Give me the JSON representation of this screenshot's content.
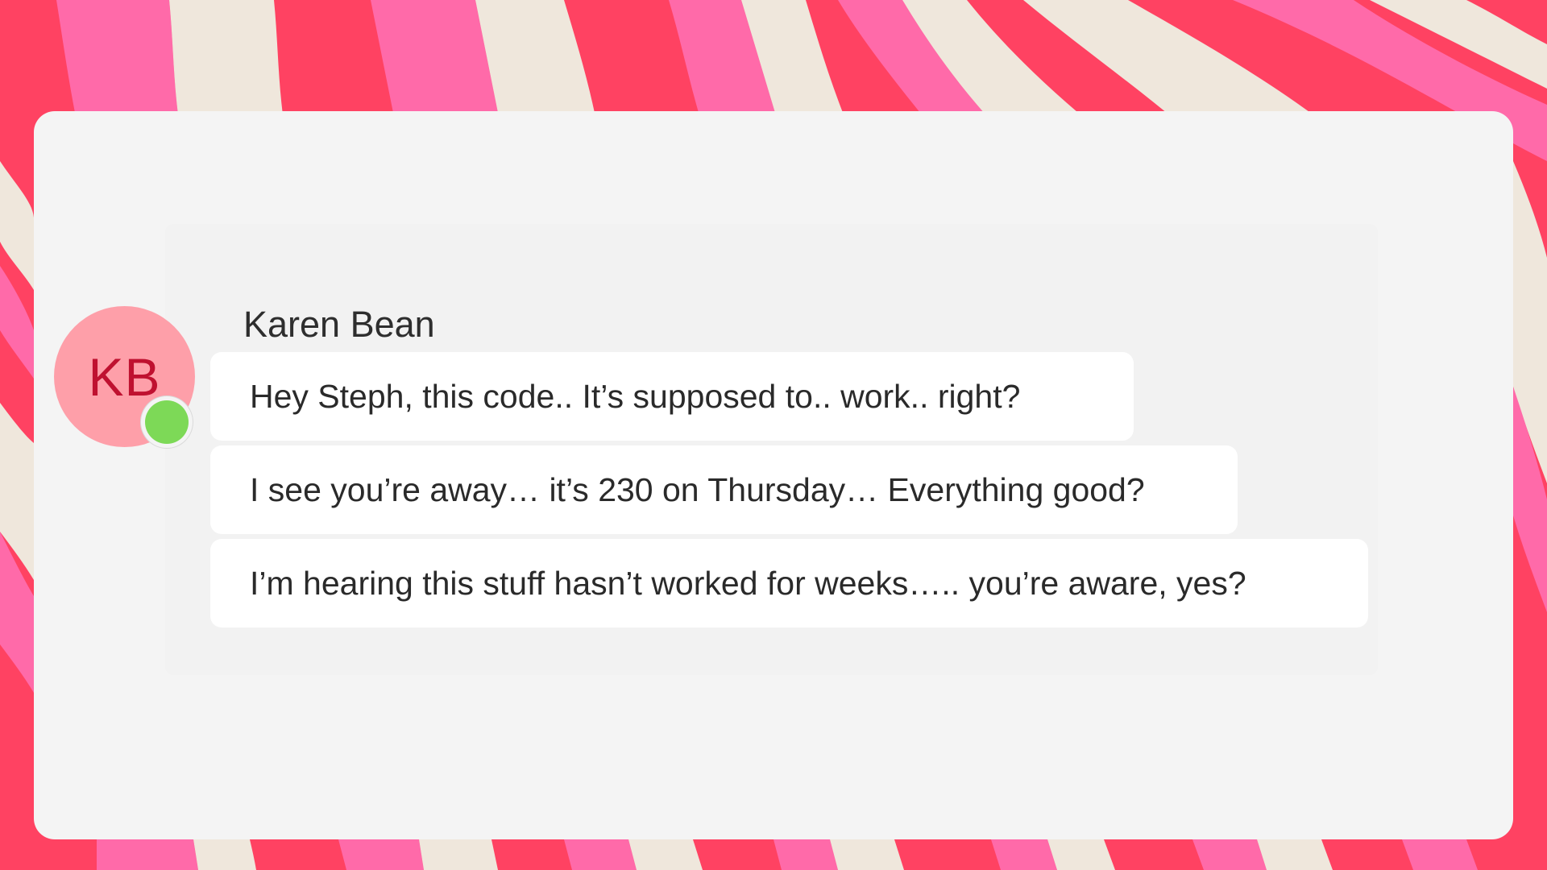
{
  "colors": {
    "stripe_red": "#ff4262",
    "stripe_pink": "#ff6aa9",
    "stripe_cream": "#efe7dc",
    "card_bg": "#f4f4f4",
    "avatar_bg": "#fe9fa9",
    "avatar_text": "#bf1130",
    "presence_online": "#7dd957"
  },
  "chat": {
    "avatar_initials": "KB",
    "presence_icon": "online-status-dot",
    "sender_name": "Karen Bean",
    "messages": [
      "Hey Steph, this code.. It’s supposed to.. work.. right?",
      "I see you’re away… it’s 230 on Thursday… Everything good?",
      "I’m hearing this stuff hasn’t worked for weeks….. you’re aware, yes?"
    ]
  }
}
